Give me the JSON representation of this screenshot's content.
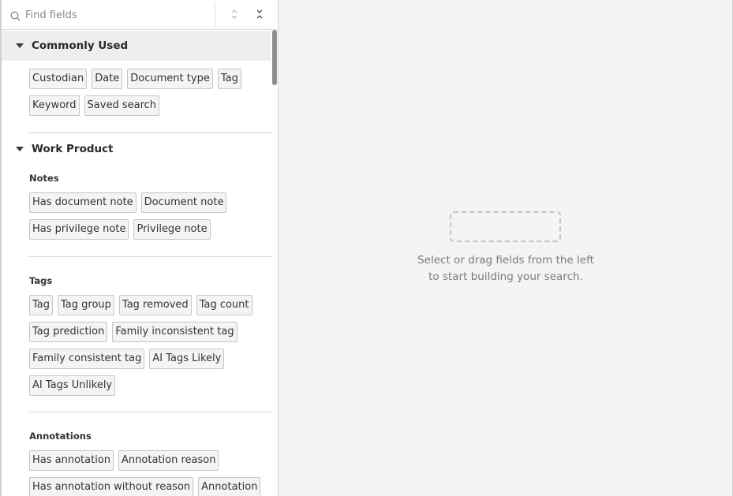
{
  "search": {
    "placeholder": "Find fields"
  },
  "toolbar": {
    "expand_all_icon": "expand-vertical-icon",
    "collapse_all_icon": "collapse-vertical-icon"
  },
  "sections": {
    "commonly_used": {
      "title": "Commonly Used",
      "fields": [
        "Custodian",
        "Date",
        "Document type",
        "Tag",
        "Keyword",
        "Saved search"
      ]
    },
    "work_product": {
      "title": "Work Product",
      "notes": {
        "title": "Notes",
        "fields": [
          "Has document note",
          "Document note",
          "Has privilege note",
          "Privilege note"
        ]
      },
      "tags": {
        "title": "Tags",
        "fields": [
          "Tag",
          "Tag group",
          "Tag removed",
          "Tag count",
          "Tag prediction",
          "Family inconsistent tag",
          "Family consistent tag",
          "AI Tags Likely",
          "AI Tags Unlikely"
        ]
      },
      "annotations": {
        "title": "Annotations",
        "fields": [
          "Has annotation",
          "Annotation reason",
          "Has annotation without reason",
          "Annotation"
        ]
      }
    }
  },
  "empty_state": {
    "line1": "Select or drag fields from the left",
    "line2": "to start building your search."
  },
  "colors": {
    "panel_bg": "#ffffff",
    "canvas_bg": "#f4f4f5",
    "chip_border": "#c6c6c9",
    "header_highlight": "#eeeeef"
  }
}
